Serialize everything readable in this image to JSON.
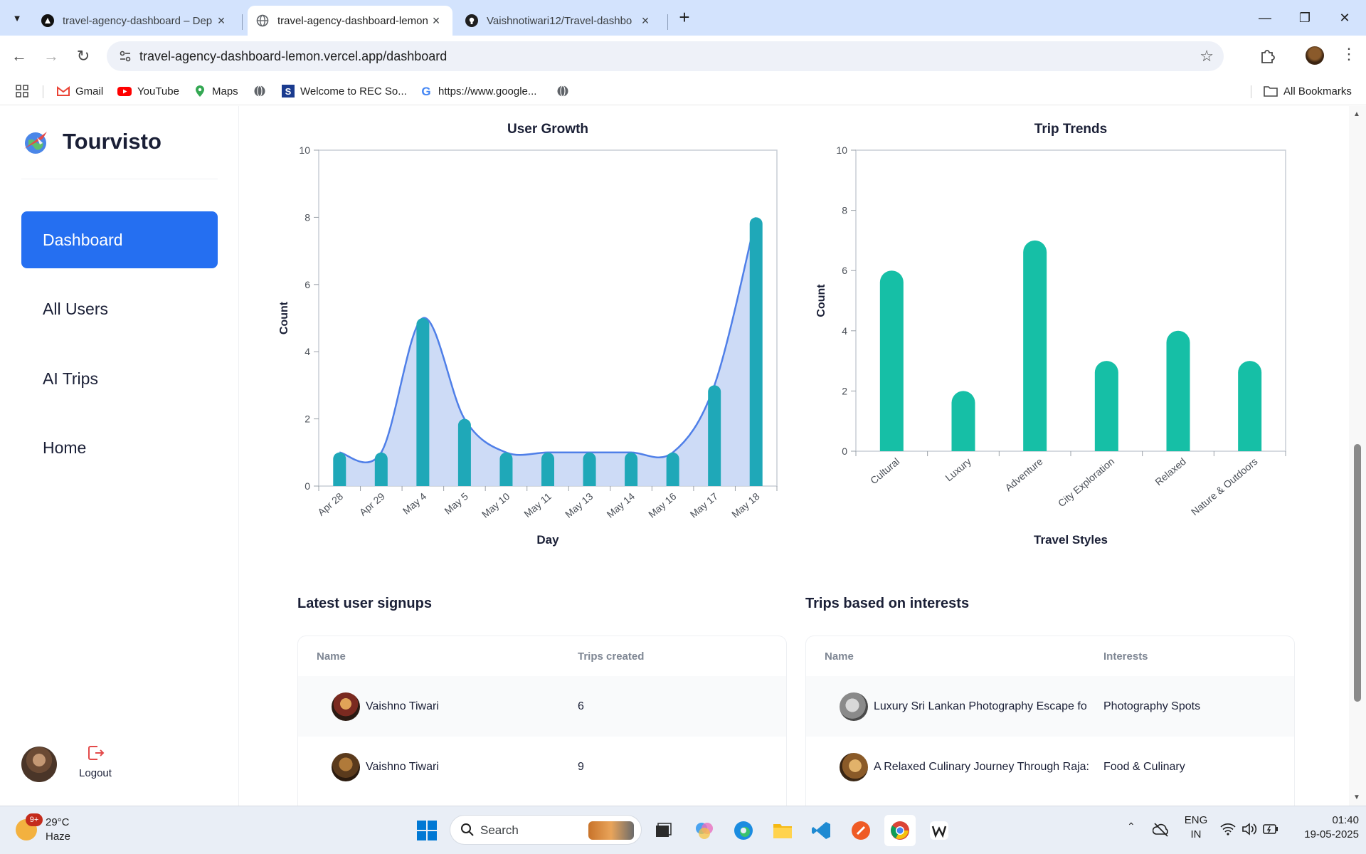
{
  "browser": {
    "tabs": [
      {
        "title": "travel-agency-dashboard – Dep",
        "active": false
      },
      {
        "title": "travel-agency-dashboard-lemon",
        "active": true
      },
      {
        "title": "Vaishnotiwari12/Travel-dashbo",
        "active": false
      }
    ],
    "url": "travel-agency-dashboard-lemon.vercel.app/dashboard",
    "bookmarks": [
      "Gmail",
      "YouTube",
      "Maps",
      "Welcome to REC So...",
      "https://www.google..."
    ],
    "all_bookmarks": "All Bookmarks"
  },
  "sidebar": {
    "brand": "Tourvisto",
    "nav": [
      {
        "label": "Dashboard",
        "active": true
      },
      {
        "label": "All Users",
        "active": false
      },
      {
        "label": "AI Trips",
        "active": false
      },
      {
        "label": "Home",
        "active": false
      }
    ],
    "logout_label": "Logout"
  },
  "charts": {
    "accent": "#1fb8a8",
    "line_color": "#4f7fe8",
    "area_color": "#c8d7f5"
  },
  "chart_data": [
    {
      "type": "bar",
      "title": "User Growth",
      "xlabel": "Day",
      "ylabel": "Count",
      "ylim": [
        0,
        10
      ],
      "yticks": [
        0,
        2,
        4,
        6,
        8,
        10
      ],
      "categories": [
        "Apr 28",
        "Apr 29",
        "May 4",
        "May 5",
        "May 10",
        "May 11",
        "May 13",
        "May 14",
        "May 16",
        "May 17",
        "May 18"
      ],
      "values": [
        1,
        1,
        5,
        2,
        1,
        1,
        1,
        1,
        1,
        3,
        8
      ],
      "overlay": "spline-area",
      "grid": false
    },
    {
      "type": "bar",
      "title": "Trip Trends",
      "xlabel": "Travel Styles",
      "ylabel": "Count",
      "ylim": [
        0,
        10
      ],
      "yticks": [
        0,
        2,
        4,
        6,
        8,
        10
      ],
      "categories": [
        "Cultural",
        "Luxury",
        "Adventure",
        "City Exploration",
        "Relaxed",
        "Nature & Outdoors"
      ],
      "values": [
        6,
        2,
        7,
        3,
        4,
        3
      ],
      "grid": false
    }
  ],
  "signups": {
    "title": "Latest user signups",
    "columns": [
      "Name",
      "Trips created"
    ],
    "rows": [
      {
        "name": "Vaishno Tiwari",
        "trips": "6"
      },
      {
        "name": "Vaishno Tiwari",
        "trips": "9"
      }
    ]
  },
  "interests": {
    "title": "Trips based on interests",
    "columns": [
      "Name",
      "Interests"
    ],
    "rows": [
      {
        "name": "Luxury Sri Lankan Photography Escape fo",
        "interest": "Photography Spots"
      },
      {
        "name": "A Relaxed Culinary Journey Through Raja:",
        "interest": "Food & Culinary"
      }
    ]
  },
  "taskbar": {
    "weather_temp": "29°C",
    "weather_cond": "Haze",
    "weather_badge": "9+",
    "search_label": "Search",
    "lang_1": "ENG",
    "lang_2": "IN",
    "time": "01:40",
    "date": "19-05-2025"
  }
}
